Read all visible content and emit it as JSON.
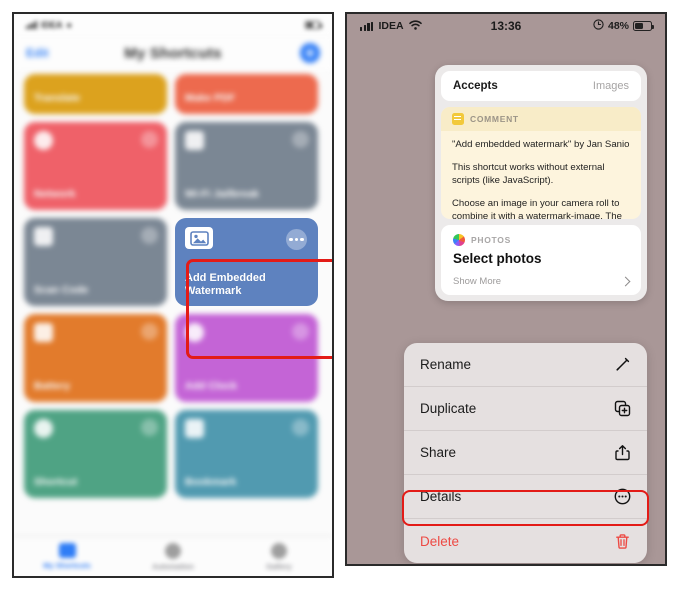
{
  "left_phone": {
    "status_bar": {
      "carrier": "IDEA",
      "time": "",
      "battery": "",
      "signal_icon": "signal-bars-icon",
      "wifi_icon": "wifi-icon",
      "battery_icon": "battery-icon"
    },
    "nav": {
      "edit_label": "Edit",
      "title": "My Shortcuts",
      "add_label": "add-shortcut"
    },
    "tiles": [
      {
        "name": "Translate",
        "color": "#dca21e",
        "size": "small"
      },
      {
        "name": "Make PDF",
        "color": "#ed6a4e",
        "size": "small"
      },
      {
        "name": "Network",
        "color": "#ef6169",
        "size": "large",
        "icon": "power-icon"
      },
      {
        "name": "Wi-Fi Jailbreak",
        "color": "#7b8794",
        "size": "large",
        "icon": "wrench-icon"
      },
      {
        "name": "Scan Code",
        "color": "#7b8794",
        "size": "large",
        "icon": "qr-icon"
      },
      {
        "name": "Add Embedded Watermark",
        "color": "#5e82bf",
        "size": "large",
        "icon": "photo-icon",
        "focused": true
      },
      {
        "name": "Battery",
        "color": "#e27b2c",
        "size": "large",
        "icon": "droplet-icon"
      },
      {
        "name": "Add Clock",
        "color": "#c464d6",
        "size": "large",
        "icon": "clock-icon"
      },
      {
        "name": "Shortcut",
        "color": "#4fa384",
        "size": "large",
        "icon": "globe-icon"
      },
      {
        "name": "Bookmark",
        "color": "#519ab0",
        "size": "large",
        "icon": "bookmark-icon"
      }
    ],
    "tabs": [
      {
        "label": "My Shortcuts",
        "icon": "shortcuts-icon",
        "active": true
      },
      {
        "label": "Automation",
        "icon": "automation-icon",
        "active": false
      },
      {
        "label": "Gallery",
        "icon": "gallery-icon",
        "active": false
      }
    ]
  },
  "right_phone": {
    "status_bar": {
      "carrier": "IDEA",
      "time": "13:36",
      "battery_percent": "48%",
      "signal_icon": "signal-bars-icon",
      "wifi_icon": "wifi-icon",
      "alarm_icon": "alarm-clock-icon",
      "battery_icon": "battery-icon"
    },
    "detail_card": {
      "accepts_label": "Accepts",
      "accepts_value": "Images",
      "comment": {
        "badge": "COMMENT",
        "lines": [
          "\"Add embedded watermark\" by Jan Sanio",
          "This shortcut works without external scripts (like JavaScript).",
          "Choose an image in your camera roll to combine it with a watermark-image. The"
        ]
      },
      "photos_action": {
        "badge": "PHOTOS",
        "title": "Select photos",
        "show_more": "Show More",
        "chevron_icon": "chevron-right-icon"
      }
    },
    "action_menu": [
      {
        "label": "Rename",
        "icon": "pencil-icon",
        "danger": false,
        "highlighted": false
      },
      {
        "label": "Duplicate",
        "icon": "duplicate-icon",
        "danger": false,
        "highlighted": false
      },
      {
        "label": "Share",
        "icon": "share-icon",
        "danger": false,
        "highlighted": false
      },
      {
        "label": "Details",
        "icon": "ellipsis-circle-icon",
        "danger": false,
        "highlighted": true
      },
      {
        "label": "Delete",
        "icon": "trash-icon",
        "danger": true,
        "highlighted": false
      }
    ]
  },
  "annotation": {
    "color": "#e31b17"
  }
}
